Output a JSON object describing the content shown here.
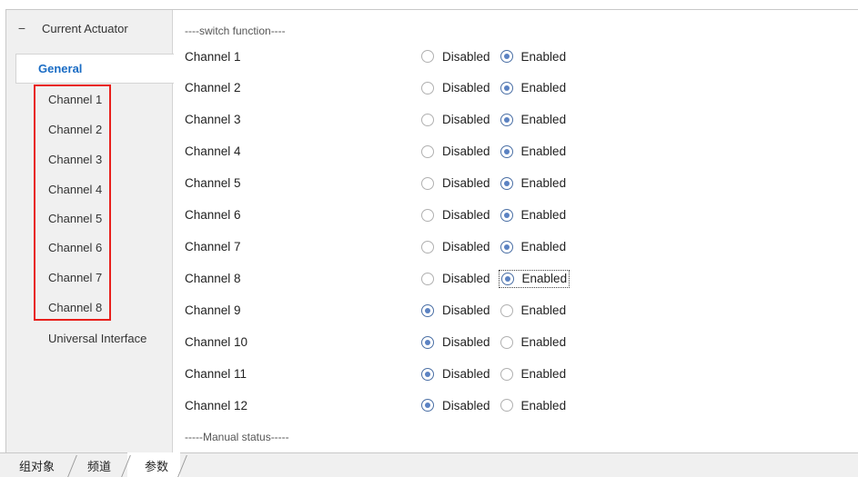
{
  "sidebar": {
    "header_label": "Current Actuator",
    "collapse_symbol": "−",
    "active_item": "General",
    "items": [
      "Channel 1",
      "Channel 2",
      "Channel 3",
      "Channel 4",
      "Channel 5",
      "Channel 6",
      "Channel 7",
      "Channel 8"
    ],
    "footer_item": "Universal Interface",
    "highlight_color": "#e8201c"
  },
  "content": {
    "section_switch": "----switch function----",
    "section_manual": "-----Manual status-----",
    "option_disabled": "Disabled",
    "option_enabled": "Enabled",
    "rows": [
      {
        "label": "Channel 1",
        "value": "Enabled"
      },
      {
        "label": "Channel 2",
        "value": "Enabled"
      },
      {
        "label": "Channel 3",
        "value": "Enabled"
      },
      {
        "label": "Channel 4",
        "value": "Enabled"
      },
      {
        "label": "Channel 5",
        "value": "Enabled"
      },
      {
        "label": "Channel 6",
        "value": "Enabled"
      },
      {
        "label": "Channel 7",
        "value": "Enabled"
      },
      {
        "label": "Channel 8",
        "value": "Enabled",
        "focused": true
      },
      {
        "label": "Channel 9",
        "value": "Disabled"
      },
      {
        "label": "Channel 10",
        "value": "Disabled"
      },
      {
        "label": "Channel 11",
        "value": "Disabled"
      },
      {
        "label": "Channel 12",
        "value": "Disabled"
      }
    ]
  },
  "tabs": {
    "items": [
      "组对象",
      "频道",
      "参数"
    ],
    "active": "参数"
  }
}
